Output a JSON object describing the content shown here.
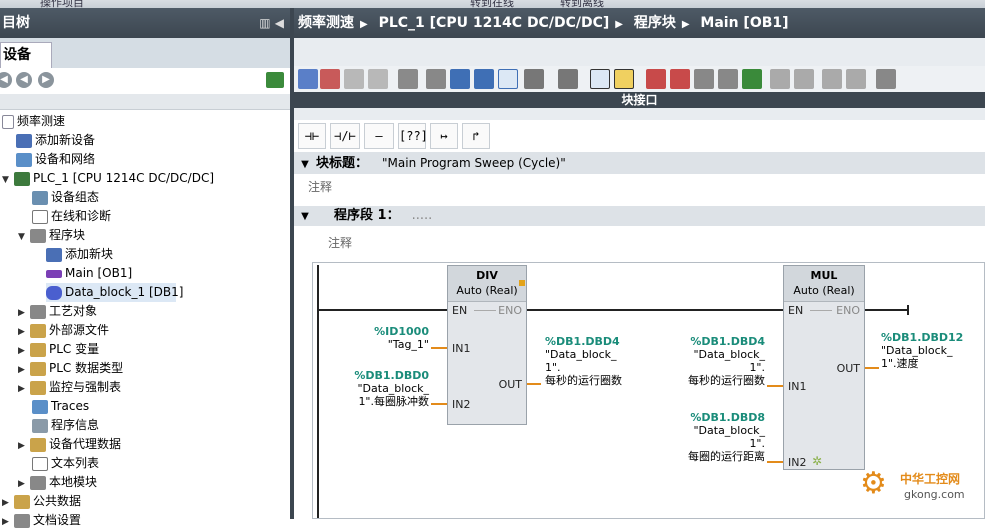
{
  "top": {
    "t1": "操作项目",
    "t2": "转到在线",
    "t3": "转到离线"
  },
  "left": {
    "title": "目树",
    "tab": "设备",
    "tree": [
      {
        "label": "频率测速"
      },
      {
        "label": "添加新设备"
      },
      {
        "label": "设备和网络"
      },
      {
        "label": "PLC_1 [CPU 1214C DC/DC/DC]"
      },
      {
        "label": "设备组态"
      },
      {
        "label": "在线和诊断"
      },
      {
        "label": "程序块"
      },
      {
        "label": "添加新块"
      },
      {
        "label": "Main [OB1]"
      },
      {
        "label": "Data_block_1 [DB1]"
      },
      {
        "label": "工艺对象"
      },
      {
        "label": "外部源文件"
      },
      {
        "label": "PLC 变量"
      },
      {
        "label": "PLC 数据类型"
      },
      {
        "label": "监控与强制表"
      },
      {
        "label": "Traces"
      },
      {
        "label": "程序信息"
      },
      {
        "label": "设备代理数据"
      },
      {
        "label": "文本列表"
      },
      {
        "label": "本地模块"
      },
      {
        "label": "公共数据"
      },
      {
        "label": "文档设置"
      }
    ]
  },
  "breadcrumb": [
    "频率测速",
    "PLC_1 [CPU 1214C DC/DC/DC]",
    "程序块",
    "Main [OB1]"
  ],
  "interface_label": "块接口",
  "ladder_buttons": [
    "⊣⊢",
    "⊣/⊢",
    "–()–",
    "[??]",
    "↦",
    "↱"
  ],
  "block_title": {
    "label": "块标题：",
    "value": "\"Main Program Sweep (Cycle)\"",
    "comment": "注释"
  },
  "segment": {
    "label": "程序段 1：",
    "value": ".....",
    "comment": "注释"
  },
  "div": {
    "name": "DIV",
    "type": "Auto (Real)",
    "en": "EN",
    "eno": "ENO",
    "in1": "IN1",
    "in2": "IN2",
    "out": "OUT",
    "in1_addr": "%ID1000",
    "in1_tag": "\"Tag_1\"",
    "in2_addr": "%DB1.DBD0",
    "in2_l1": "\"Data_block_",
    "in2_l2": "1\".每圈脉冲数",
    "out_addr": "%DB1.DBD4",
    "out_l1": "\"Data_block_",
    "out_l2": "1\".",
    "out_l3": "每秒的运行圈数"
  },
  "mul": {
    "name": "MUL",
    "type": "Auto (Real)",
    "en": "EN",
    "eno": "ENO",
    "in1": "IN1",
    "in2": "IN2",
    "out": "OUT",
    "in1_addr": "%DB1.DBD4",
    "in1_l1": "\"Data_block_",
    "in1_l2": "1\".",
    "in1_l3": "每秒的运行圈数",
    "in2_addr": "%DB1.DBD8",
    "in2_l1": "\"Data_block_",
    "in2_l2": "1\".",
    "in2_l3": "每圈的运行距离",
    "out_addr": "%DB1.DBD12",
    "out_l1": "\"Data_block_",
    "out_l2": "1\".速度"
  },
  "watermark": {
    "cn": "中华工控网",
    "url": "gkong.com"
  }
}
